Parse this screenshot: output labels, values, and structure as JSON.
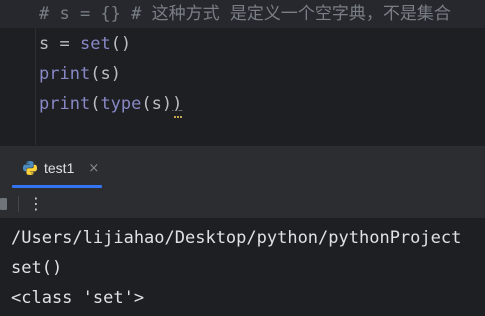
{
  "editor": {
    "lines": [
      {
        "comment": "# s = {} # 这种方式 是定义一个空字典，不是集合"
      },
      {
        "var": "s",
        "op": " = ",
        "func": "set",
        "args": "()"
      },
      {
        "func": "print",
        "open": "(",
        "arg": "s",
        "close": ")"
      },
      {
        "outer": "print",
        "open1": "(",
        "inner": "type",
        "open2": "(",
        "arg": "s",
        "close2": ")",
        "close1": ")"
      }
    ]
  },
  "run_panel": {
    "tab_label": "test1",
    "tab_icon": "python-icon",
    "close_glyph": "×",
    "more_glyph": "⋮",
    "accent": "#3574f0"
  },
  "console": {
    "lines": [
      "/Users/lijiahao/Desktop/python/pythonProject",
      "set()",
      "<class 'set'>"
    ]
  }
}
